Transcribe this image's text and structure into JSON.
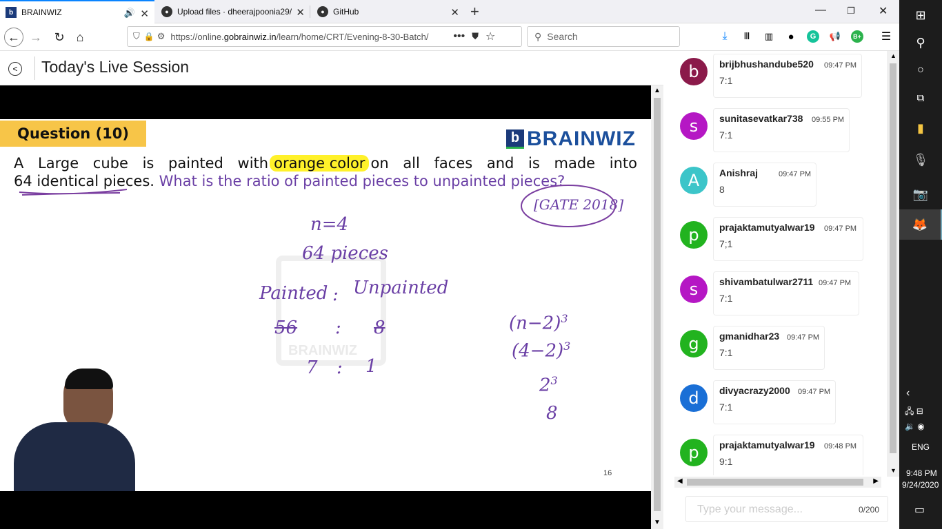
{
  "browser": {
    "tabs": [
      {
        "title": "BRAINWIZ",
        "active": true
      },
      {
        "title": "Upload files · dheerajpoonia29/",
        "active": false
      },
      {
        "title": "GitHub",
        "active": false
      }
    ],
    "new_tab": "+",
    "url_prefix": "https://online.",
    "url_domain": "gobrainwiz.in",
    "url_path": "/learn/home/CRT/Evening-8-30-Batch/",
    "search_placeholder": "Search"
  },
  "page": {
    "title": "Today's Live Session"
  },
  "slide": {
    "question_label": "Question (10)",
    "brand": "BRAINWIZ",
    "q_line1_a": "A Large cube is painted with",
    "q_highlight": "orange color",
    "q_line1_b": "on all faces and is made into",
    "q_line2_a": "64 identical pieces.",
    "q_line2_b": "What is the ratio of painted pieces to unpainted pieces?",
    "source": "[GATE 2018]",
    "page_number": "16",
    "watermark": "BRAINWIZ",
    "handwriting": {
      "n": "n=4",
      "pieces": "64 pieces",
      "painted": "Painted",
      "colon": ":",
      "unpainted": "Unpainted",
      "v56": "56",
      "v8": "8",
      "v7": "7",
      "v1": "1",
      "f1": "(n−2)",
      "f2": "(4−2)",
      "f3": "2",
      "exp": "3",
      "f4": "8"
    }
  },
  "chat": {
    "messages": [
      {
        "initial": "b",
        "color": "#8b1a4a",
        "user": "brijbhushandube520",
        "time": "09:47 PM",
        "text": "7:1"
      },
      {
        "initial": "s",
        "color": "#b517c4",
        "user": "sunitasevatkar738",
        "time": "09:55 PM",
        "text": "7:1"
      },
      {
        "initial": "A",
        "color": "#3cc5c9",
        "user": "Anishraj",
        "time": "09:47 PM",
        "text": "8"
      },
      {
        "initial": "p",
        "color": "#22b31f",
        "user": "prajaktamutyalwar19",
        "time": "09:47 PM",
        "text": "7;1"
      },
      {
        "initial": "s",
        "color": "#b517c4",
        "user": "shivambatulwar2711",
        "time": "09:47 PM",
        "text": "7:1"
      },
      {
        "initial": "g",
        "color": "#22b31f",
        "user": "gmanidhar23",
        "time": "09:47 PM",
        "text": "7:1"
      },
      {
        "initial": "d",
        "color": "#1a6fd6",
        "user": "divyacrazy2000",
        "time": "09:47 PM",
        "text": "7:1"
      },
      {
        "initial": "p",
        "color": "#22b31f",
        "user": "prajaktamutyalwar19",
        "time": "09:48 PM",
        "text": "9:1"
      }
    ],
    "input_placeholder": "Type your message...",
    "char_count": "0/200"
  },
  "taskbar": {
    "lang": "ENG",
    "time": "9:48 PM",
    "date": "9/24/2020"
  }
}
